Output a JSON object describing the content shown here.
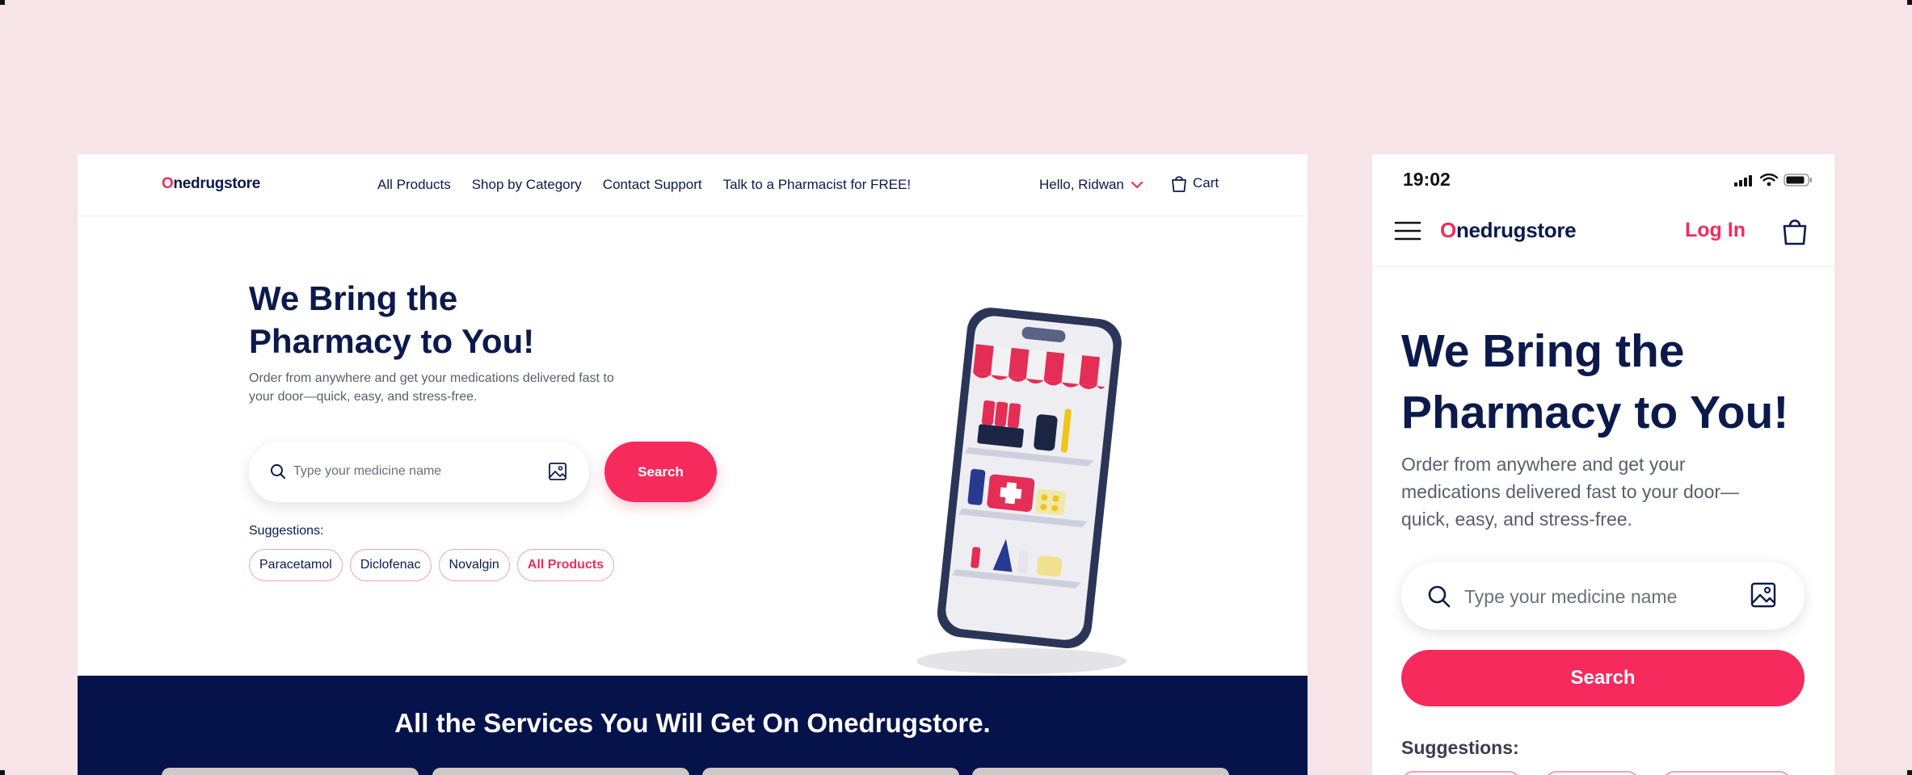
{
  "desktop": {
    "logo_o": "O",
    "logo_rest": "nedrugstore",
    "nav_links": [
      "All Products",
      "Shop by Category",
      "Contact Support",
      "Talk to a Pharmacist for FREE!"
    ],
    "user_greeting": "Hello, Ridwan",
    "cart_label": "Cart",
    "hero_title": "We Bring the Pharmacy to You!",
    "hero_subtitle": "Order from anywhere and get your medications delivered fast to your door—quick, easy, and stress-free.",
    "search_placeholder": "Type your medicine name",
    "search_button": "Search",
    "suggestions_label": "Suggestions:",
    "suggestions": [
      "Paracetamol",
      "Diclofenac",
      "Novalgin",
      "All Products"
    ],
    "services_title": "All the Services You Will Get On Onedrugstore."
  },
  "mobile": {
    "time": "19:02",
    "logo_o": "O",
    "logo_rest": "nedrugstore",
    "login_label": "Log In",
    "hero_title": "We Bring the Pharmacy to You!",
    "hero_subtitle": "Order from anywhere and get your medications delivered fast to your door—quick, easy, and stress-free.",
    "search_placeholder": "Type your medicine name",
    "search_button": "Search",
    "suggestions_label": "Suggestions:"
  },
  "colors": {
    "brand_navy": "#0c1a4b",
    "brand_pink": "#f62a5c",
    "page_background": "#f7e4e8",
    "band_navy": "#06124a"
  },
  "icons": [
    "search-icon",
    "image-upload-icon",
    "chevron-down-icon",
    "cart-icon",
    "menu-icon",
    "shopping-bag-icon",
    "signal-icon",
    "wifi-icon",
    "battery-icon"
  ]
}
